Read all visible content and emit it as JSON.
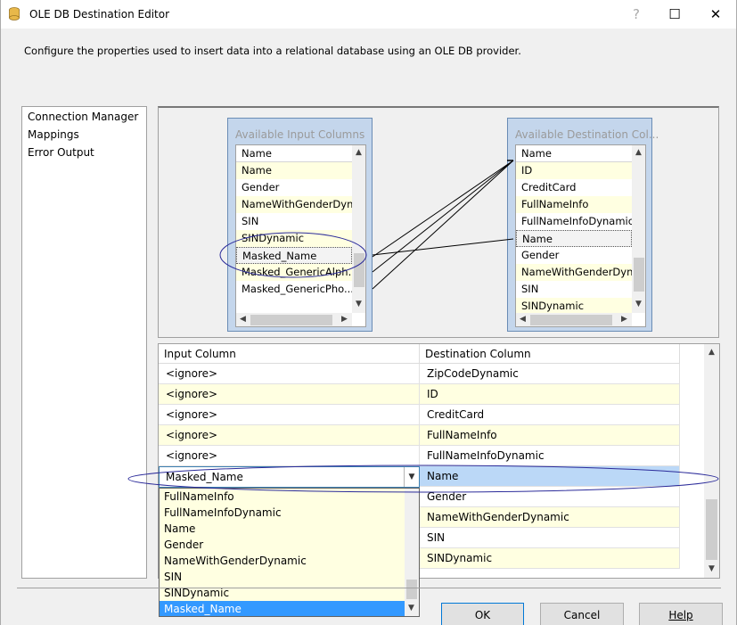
{
  "window": {
    "title": "OLE DB Destination Editor",
    "help_glyph": "?",
    "maximize_glyph": "☐",
    "close_glyph": "✕"
  },
  "description": "Configure the properties used to insert data into a relational database using an OLE DB provider.",
  "nav": {
    "items": [
      "Connection Manager",
      "Mappings",
      "Error Output"
    ]
  },
  "available_input": {
    "title": "Available Input Columns",
    "header": "Name",
    "columns": [
      "Name",
      "Gender",
      "NameWithGenderDyn...",
      "SIN",
      "SINDynamic",
      "Masked_Name",
      "Masked_GenericAlph...",
      "Masked_GenericPho..."
    ]
  },
  "available_destination": {
    "title": "Available Destination Col...",
    "header": "Name",
    "columns": [
      "ID",
      "CreditCard",
      "FullNameInfo",
      "FullNameInfoDynamic",
      "Name",
      "Gender",
      "NameWithGenderDyn...",
      "SIN",
      "SINDynamic"
    ]
  },
  "grid": {
    "headers": [
      "Input Column",
      "Destination Column"
    ],
    "rows": [
      {
        "input": "<ignore>",
        "destination": "ZipCodeDynamic"
      },
      {
        "input": "<ignore>",
        "destination": "ID"
      },
      {
        "input": "<ignore>",
        "destination": "CreditCard"
      },
      {
        "input": "<ignore>",
        "destination": "FullNameInfo"
      },
      {
        "input": "<ignore>",
        "destination": "FullNameInfoDynamic"
      },
      {
        "input": "Masked_Name",
        "destination": "Name"
      },
      {
        "input": "",
        "destination": "Gender"
      },
      {
        "input": "",
        "destination": "NameWithGenderDynamic"
      },
      {
        "input": "",
        "destination": "SIN"
      },
      {
        "input": "",
        "destination": "SINDynamic"
      }
    ]
  },
  "dropdown": {
    "selected": "Masked_Name",
    "options": [
      "FullNameInfo",
      "FullNameInfoDynamic",
      "Name",
      "Gender",
      "NameWithGenderDynamic",
      "SIN",
      "SINDynamic",
      "Masked_Name"
    ]
  },
  "buttons": {
    "ok": "OK",
    "cancel": "Cancel",
    "help": "Help"
  },
  "colors": {
    "highlight_row": "#bbd8f7",
    "alt_row": "#ffffe1",
    "selection": "#3399ff",
    "annotation_ellipse": "#2b2b9a"
  }
}
